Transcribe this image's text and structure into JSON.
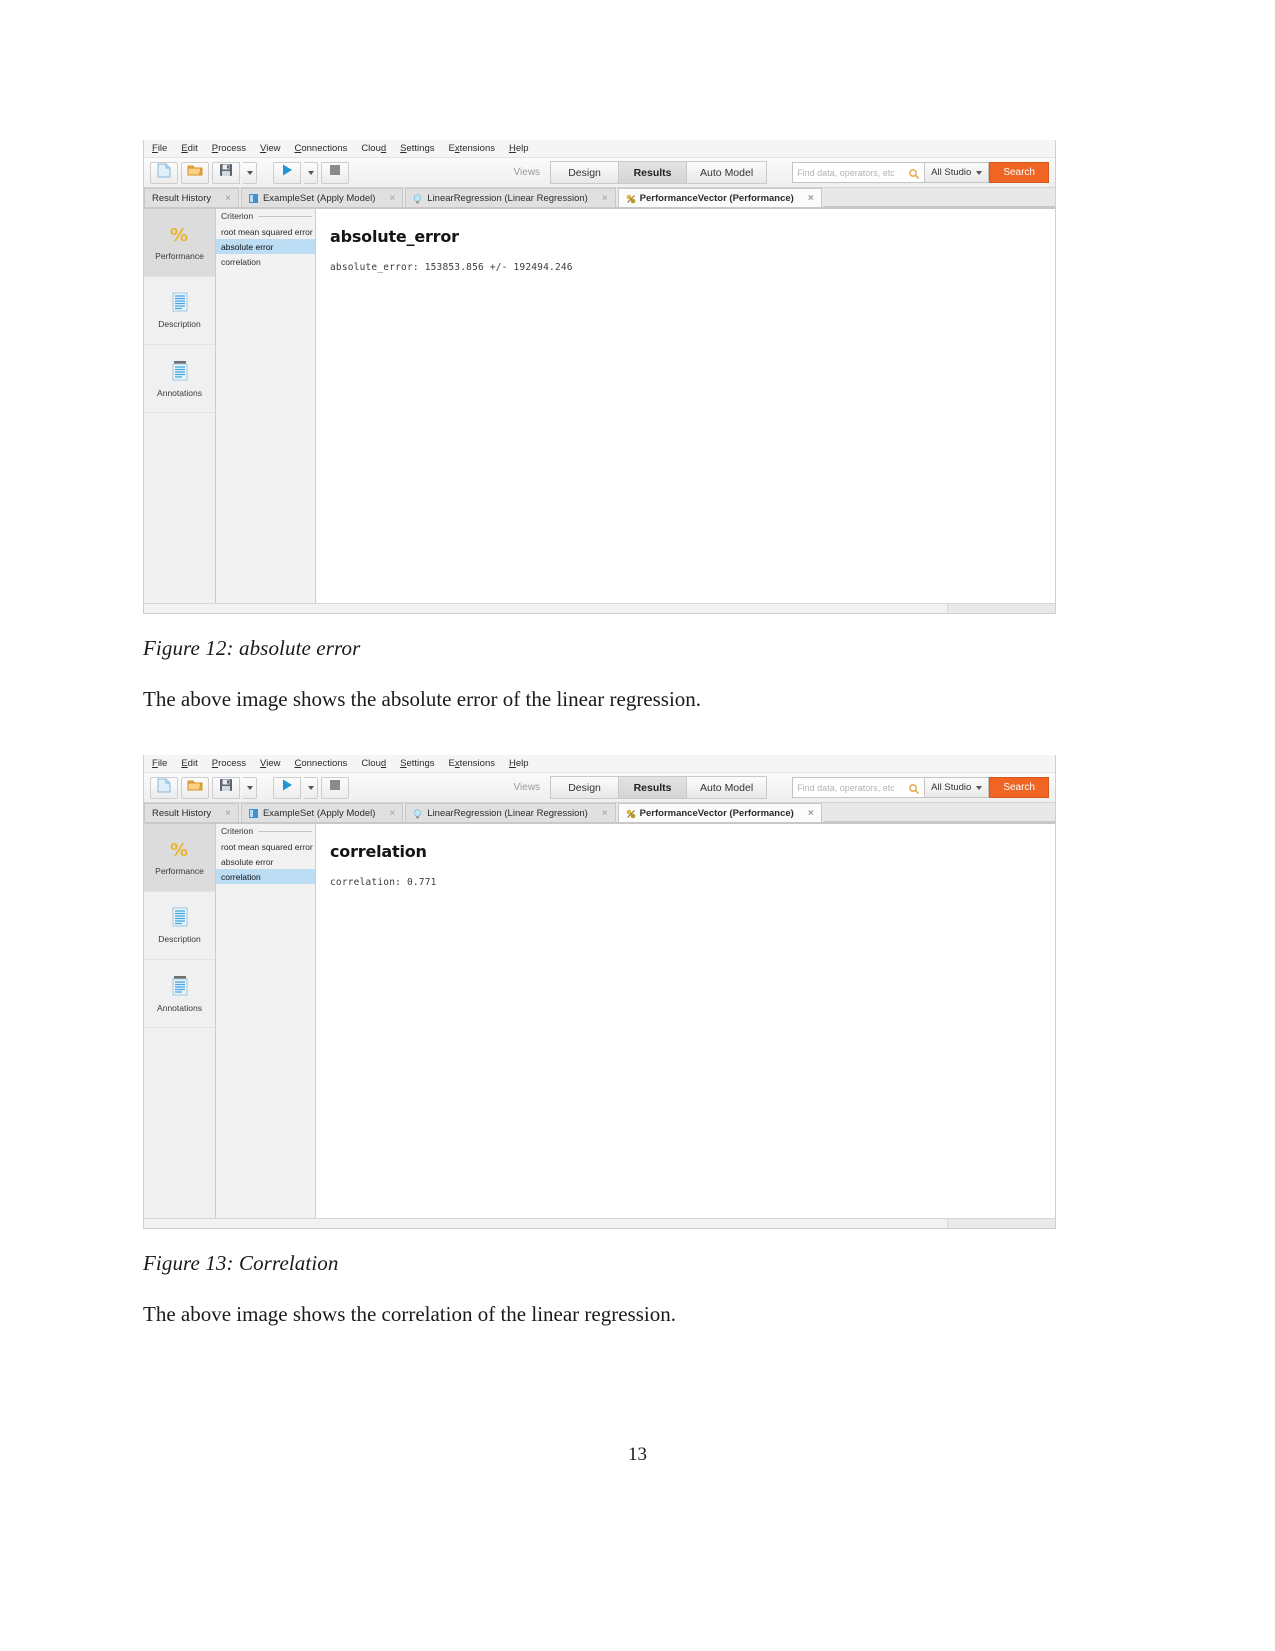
{
  "document": {
    "page_number": "13",
    "figure12_caption": "Figure 12: absolute error",
    "figure12_text": "The above image shows the absolute error of the linear regression.",
    "figure13_caption": "Figure 13: Correlation",
    "figure13_text": "The above image shows the correlation of the linear regression."
  },
  "app": {
    "menubar": [
      {
        "label": "File",
        "mnemonic": "F",
        "rest": "ile"
      },
      {
        "label": "Edit",
        "mnemonic": "E",
        "rest": "dit"
      },
      {
        "label": "Process",
        "mnemonic": "P",
        "rest": "rocess"
      },
      {
        "label": "View",
        "mnemonic": "V",
        "rest": "iew"
      },
      {
        "label": "Connections",
        "mnemonic": "C",
        "rest": "onnections"
      },
      {
        "label": "Cloud",
        "mnemonic": "Cl",
        "rest": "oud"
      },
      {
        "label": "Settings",
        "mnemonic": "S",
        "rest": "ettings"
      },
      {
        "label": "Extensions",
        "mnemonic": "E",
        "rest": "xtensions"
      },
      {
        "label": "Help",
        "mnemonic": "H",
        "rest": "elp"
      }
    ],
    "toolbar": {
      "new_process_icon": "new-process-icon",
      "open_process_icon": "open-folder-icon",
      "save_icon": "save-disk-icon",
      "run_icon": "run-play-icon",
      "stop_icon": "stop-square-icon",
      "views_label": "Views",
      "views": [
        {
          "label": "Design",
          "active": false
        },
        {
          "label": "Results",
          "active": true
        },
        {
          "label": "Auto Model",
          "active": false
        }
      ],
      "search_placeholder": "Find data, operators, etc",
      "search_value": "",
      "search_icon": "magnifier-icon",
      "scope_label": "All Studio",
      "search_button": "Search",
      "accent_color": "#f06524"
    },
    "tabs": [
      {
        "label": "Result History",
        "icon": "",
        "active": false,
        "close": "×"
      },
      {
        "label": "ExampleSet (Apply Model)",
        "icon": "exampleset-icon",
        "active": false,
        "close": "×"
      },
      {
        "label": "LinearRegression (Linear Regression)",
        "icon": "model-bulb-icon",
        "active": false,
        "close": "×"
      },
      {
        "label": "PerformanceVector (Performance)",
        "icon": "performance-icon",
        "active": true,
        "close": "×"
      }
    ],
    "sidebar": [
      {
        "label": "Performance",
        "icon": "percent-icon",
        "active": true
      },
      {
        "label": "Description",
        "icon": "description-icon",
        "active": false
      },
      {
        "label": "Annotations",
        "icon": "annotations-icon",
        "active": false
      }
    ],
    "criterion": {
      "legend": "Criterion",
      "items": [
        "root mean squared error",
        "absolute error",
        "correlation"
      ]
    }
  },
  "figure12": {
    "selected_criterion": "absolute error",
    "result_title": "absolute_error",
    "result_value": "absolute_error: 153853.856 +/- 192494.246"
  },
  "figure13": {
    "selected_criterion": "correlation",
    "result_title": "correlation",
    "result_value": "correlation: 0.771"
  }
}
